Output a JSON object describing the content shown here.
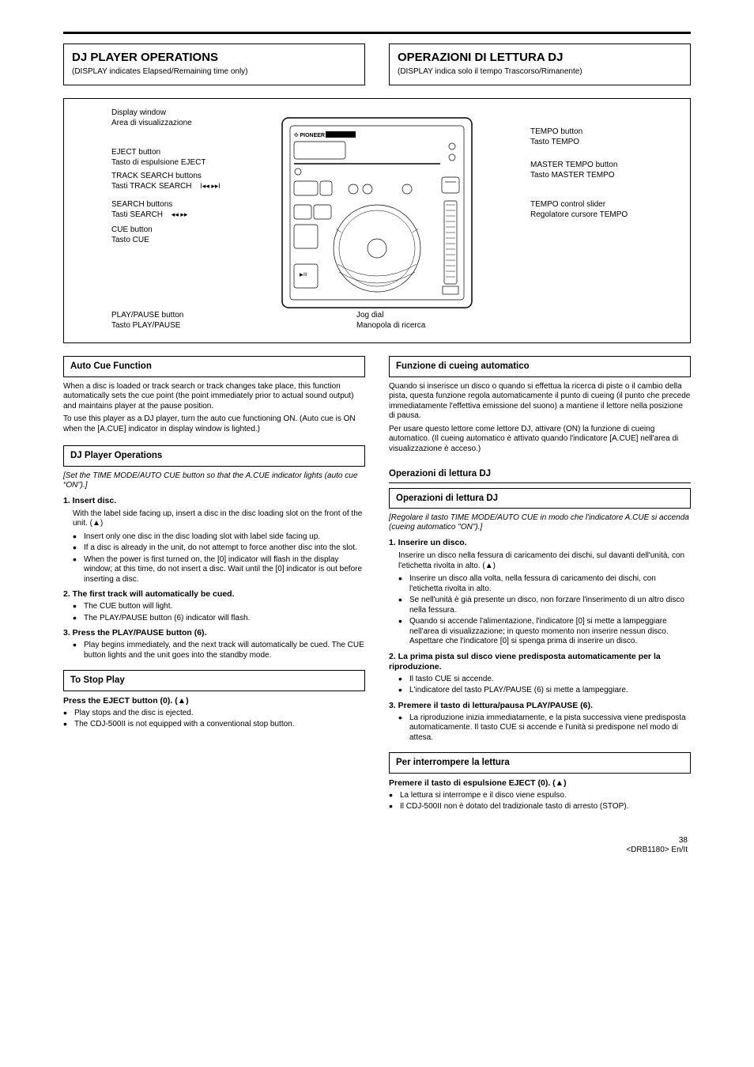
{
  "headers": {
    "left_title": "DJ PLAYER OPERATIONS",
    "left_sub": "(DISPLAY indicates Elapsed/Remaining time only)",
    "right_title": "OPERAZIONI DI LETTURA DJ",
    "right_sub": "(DISPLAY indica solo il tempo Trascorso/Rimanente)"
  },
  "diagram": {
    "brand": "PIONEER",
    "labels": {
      "display_en": "Display window",
      "display_it": "Area di visualizzazione",
      "master_en": "MASTER TEMPO button",
      "master_it": "Tasto MASTER TEMPO",
      "tempo_en": "TEMPO control slider",
      "tempo_it": "Regolatore cursore TEMPO",
      "jog": "Jog dial",
      "jog_it": "Manopola di ricerca",
      "playpause_en": "PLAY/PAUSE button",
      "playpause_it": "Tasto PLAY/PAUSE",
      "eject_en": "EJECT button",
      "eject_it": "Tasto di espulsione EJECT",
      "track_en": "TRACK SEARCH buttons",
      "track_it": "Tasti TRACK SEARCH",
      "search_en": "SEARCH buttons",
      "search_it": "Tasti SEARCH",
      "cue_en": "CUE button",
      "cue_it": "Tasto CUE",
      "tempo_btn_en": "TEMPO button",
      "tempo_btn_it": "Tasto TEMPO"
    }
  },
  "left": {
    "subhead1": "Auto Cue Function",
    "para1a": "When a disc is loaded or track search or track changes take place, this function automatically sets the cue point (the point immediately prior to actual sound output) and maintains player at the pause position.",
    "para1b": "To use this player as a DJ player, turn the auto cue functioning ON. (Auto cue is ON when the [A.CUE] indicator in display window is lighted.)",
    "subhead2": "DJ Player Operations",
    "pre": "[Set the TIME MODE/AUTO CUE button so that the A.CUE indicator lights (auto cue “ON”).]",
    "step1": "1. Insert disc.",
    "step1_b1": "Insert only one disc in the disc loading slot with label side facing up.",
    "step1_b2": "If a disc is already in the unit, do not attempt to force another disc into the slot.",
    "step1_b3": "When the power is first turned on, the [0] indicator will flash in the display window; at this time, do not insert a disc. Wait until the [0] indicator is out before inserting a disc.",
    "step2": "2. The first track will automatically be cued.",
    "step2_b1": "The CUE button will light.",
    "step2_b2": "The PLAY/PAUSE button (6) indicator will flash.",
    "step3": "3. Press the PLAY/PAUSE button (6).",
    "step3_b1": "Play begins immediately, and the next track will automatically be cued. The CUE button lights and the unit goes into the standby mode.",
    "subhead3": "To Stop Play",
    "stop1": "Press the EJECT button (0).",
    "stop_b1": "Play stops and the disc is ejected.",
    "stop_b2": "The CDJ-500II is not equipped with a conventional stop button."
  },
  "right": {
    "subhead1": "Funzione di cueing automatico",
    "para1a": "Quando si inserisce un disco o quando si effettua la ricerca di piste o il cambio della pista, questa funzione regola automaticamente il punto di cueing (il punto che precede immediatamente l'effettiva emissione del suono) a mantiene il lettore nella posizione di pausa.",
    "para1b": "Per usare questo lettore come lettore DJ, attivare (ON) la funzione di cueing automatico. (Il cueing automatico è attivato quando l'indicatore [A.CUE] nell'area di visualizzazione è acceso.)",
    "maintitle": "Operazioni di lettura DJ",
    "subhead2": "Operazioni di lettura DJ",
    "pre": "[Regolare il tasto TIME MODE/AUTO CUE in modo che l'indicatore A.CUE si accenda (cueing automatico \"ON\").]",
    "step1": "1. Inserire un disco.",
    "step1_b1": "Inserire un disco alla volta, nella fessura di caricamento dei dischi, con l'etichetta rivolta in alto.",
    "step1_b2": "Se nell'unità è già presente un disco, non forzare l'inserimento di un altro disco nella fessura.",
    "step1_b3": "Quando si accende l'alimentazione, l'indicatore [0] si mette a lampeggiare nell'area di visualizzazione; in questo momento non inserire nessun disco. Aspettare che l'indicatore [0] si spenga prima di inserire un disco.",
    "step2": "2. La prima pista sul disco viene predisposta automaticamente per la riproduzione.",
    "step2_b1": "Il tasto CUE si accende.",
    "step2_b2": "L'indicatore del tasto PLAY/PAUSE (6) si mette a lampeggiare.",
    "step3": "3. Premere il tasto di lettura/pausa PLAY/PAUSE (6).",
    "step3_b1": "La riproduzione inizia immediatamente, e la pista successiva viene predisposta automaticamente. Il tasto CUE si accende e l'unità si predispone nel modo di attesa.",
    "subhead3": "Per interrompere la lettura",
    "stop1": "Premere il tasto di espulsione EJECT (0).",
    "stop_b1": "La lettura si interrompe e il disco viene espulso.",
    "stop_b2": "Il CDJ-500II non è dotato del tradizionale tasto di arresto (STOP)."
  },
  "footer": {
    "page_en": "38",
    "page_it": "<DRB1180> En/It"
  },
  "chart_data": null
}
